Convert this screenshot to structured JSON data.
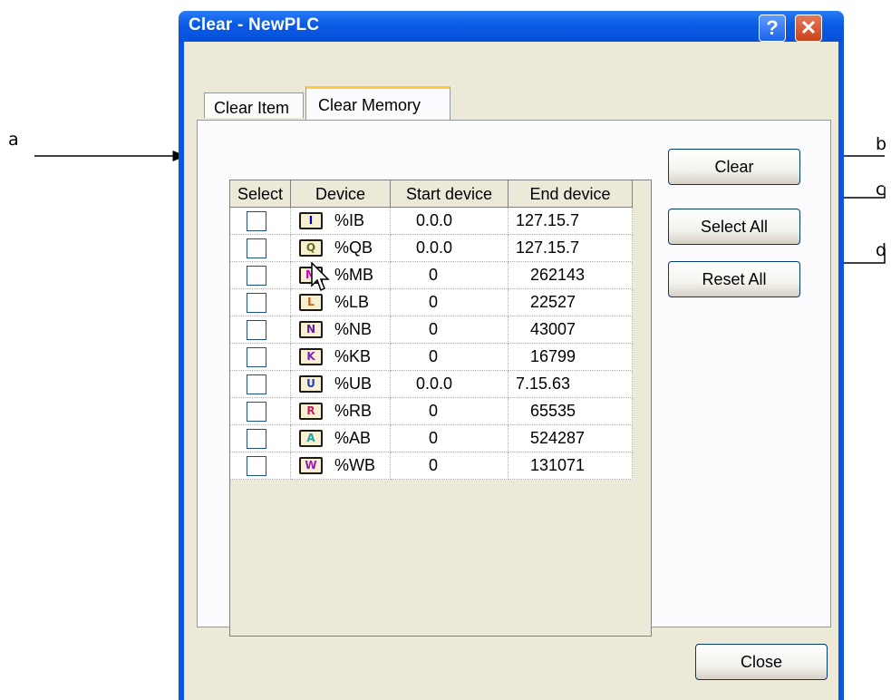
{
  "window": {
    "title": "Clear - NewPLC",
    "help_glyph": "?",
    "close_glyph": "✕"
  },
  "tabs": [
    {
      "label": "Clear Item",
      "active": false
    },
    {
      "label": "Clear Memory",
      "active": true
    }
  ],
  "grid": {
    "headers": [
      "Select",
      "Device",
      "Start device",
      "End device"
    ],
    "rows": [
      {
        "icon": "I",
        "icon_color": "#0000aa",
        "device": "%IB",
        "start": "0.0.0",
        "end": "127.15.7",
        "selected": false
      },
      {
        "icon": "Q",
        "icon_color": "#607020",
        "device": "%QB",
        "start": "0.0.0",
        "end": "127.15.7",
        "selected": false
      },
      {
        "icon": "M",
        "icon_color": "#c000c0",
        "device": "%MB",
        "start": "0",
        "end": "262143",
        "selected": false
      },
      {
        "icon": "L",
        "icon_color": "#c06010",
        "device": "%LB",
        "start": "0",
        "end": "22527",
        "selected": false
      },
      {
        "icon": "N",
        "icon_color": "#6020a0",
        "device": "%NB",
        "start": "0",
        "end": "43007",
        "selected": false
      },
      {
        "icon": "K",
        "icon_color": "#8020c0",
        "device": "%KB",
        "start": "0",
        "end": "16799",
        "selected": false
      },
      {
        "icon": "U",
        "icon_color": "#2040c0",
        "device": "%UB",
        "start": "0.0.0",
        "end": "7.15.63",
        "selected": false
      },
      {
        "icon": "R",
        "icon_color": "#c02060",
        "device": "%RB",
        "start": "0",
        "end": "65535",
        "selected": false
      },
      {
        "icon": "A",
        "icon_color": "#20a0a0",
        "device": "%AB",
        "start": "0",
        "end": "524287",
        "selected": false
      },
      {
        "icon": "W",
        "icon_color": "#9020b0",
        "device": "%WB",
        "start": "0",
        "end": "131071",
        "selected": false
      }
    ]
  },
  "buttons": {
    "clear": "Clear",
    "select_all": "Select All",
    "reset_all": "Reset All",
    "close": "Close"
  },
  "annotations": {
    "a": "a",
    "b": "b",
    "c": "c",
    "d": "d"
  },
  "colors": {
    "titlebar": "#0a54e6",
    "dialog_bg": "#ece9d8",
    "tab_highlight": "#ffc83c"
  },
  "icons": [
    "help-icon",
    "close-icon",
    "device-icon",
    "mouse-cursor-icon"
  ]
}
